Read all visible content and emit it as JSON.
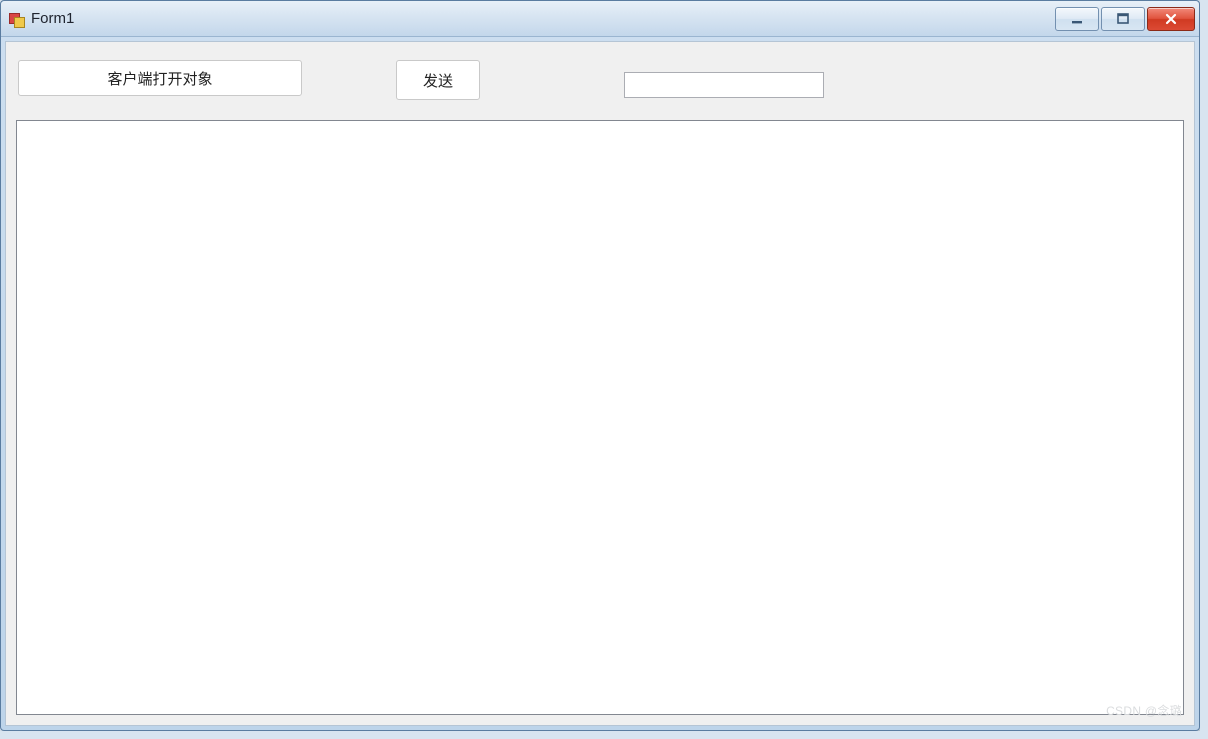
{
  "window": {
    "title": "Form1"
  },
  "buttons": {
    "open_client_label": "客户端打开对象",
    "send_label": "发送"
  },
  "inputs": {
    "message_value": "",
    "message_placeholder": ""
  },
  "output": {
    "content": ""
  },
  "watermark": "CSDN @念璐"
}
